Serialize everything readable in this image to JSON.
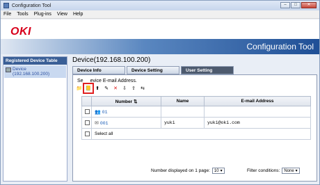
{
  "window": {
    "title": "Configuration Tool",
    "min": "–",
    "max": "□",
    "close": "✕"
  },
  "menu": [
    "File",
    "Tools",
    "Plug-ins",
    "View",
    "Help"
  ],
  "banner": {
    "logo": "OKI",
    "product": "Configuration Tool"
  },
  "sidebar": {
    "header": "Registered Device Table",
    "item_name": "Device",
    "item_ip": "(192.168.100.200)"
  },
  "main": {
    "device_title": "Device(192.168.100.200)",
    "tabs": [
      "Device Info",
      "Device Setting",
      "User Setting"
    ],
    "instruction_prefix": "Se",
    "instruction_suffix": "evice E-mail Address.",
    "table": {
      "headers": {
        "number": "Number",
        "name": "Name",
        "email": "E-mail Address"
      },
      "rows": [
        {
          "number": "01",
          "name": "",
          "email": ""
        },
        {
          "number": "001",
          "name": "yuki",
          "email": "yuki@oki.com"
        }
      ],
      "select_all": "Select all"
    },
    "footer": {
      "displayed_label": "Number displayed on 1 page:",
      "displayed_value": "10",
      "filter_label": "Filter conditions:",
      "filter_value": "None"
    }
  },
  "icons": {
    "toolbar": [
      "folder-icon",
      "address-book-icon",
      "upload-icon",
      "edit-icon",
      "delete-icon",
      "import-icon",
      "export-icon",
      "transfer-icon"
    ],
    "bottom": [
      "upload-icon",
      "edit-icon",
      "delete-icon"
    ]
  }
}
